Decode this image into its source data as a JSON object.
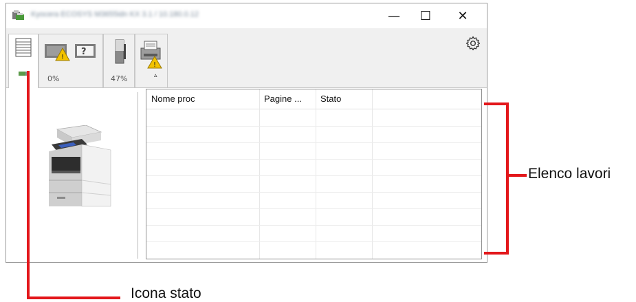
{
  "window": {
    "title": "Kyocera ECOSYS M3655idn KX 3.1 / 10.180.0.12",
    "controls": {
      "minimize": "—",
      "maximize": "☐",
      "close": "✕"
    }
  },
  "toolbar": {
    "tabs": [
      {
        "name": "print-jobs",
        "label": ""
      },
      {
        "name": "toner-paper",
        "label": "0%"
      },
      {
        "name": "toner-level",
        "label": "47%"
      },
      {
        "name": "device",
        "label": ""
      }
    ],
    "collapse_glyph": "▵",
    "settings_icon": "gear-icon"
  },
  "job_list": {
    "columns": [
      "Nome proc",
      "Pagine ...",
      "Stato",
      ""
    ],
    "rows": []
  },
  "annotations": {
    "job_list_label": "Elenco lavori",
    "status_icon_label": "Icona stato",
    "color": "#e3171b"
  }
}
